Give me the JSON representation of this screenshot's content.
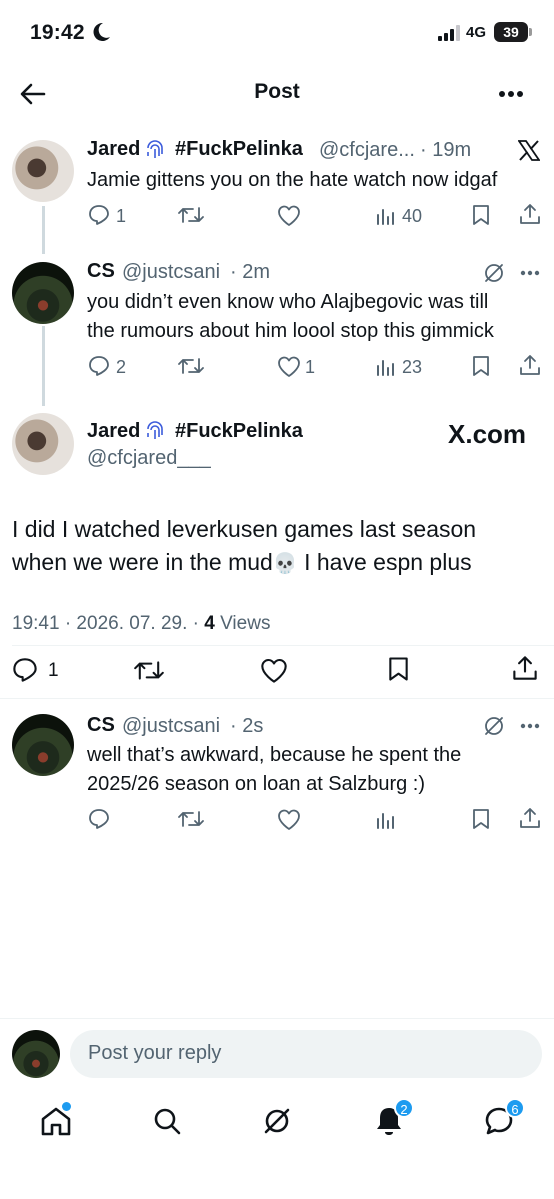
{
  "status_bar": {
    "time": "19:42",
    "network": "4G",
    "battery": "39"
  },
  "header": {
    "title": "Post"
  },
  "replied_post_1": {
    "author_name": "Jared",
    "author_tag": "#FuckPelinka",
    "handle": "@cfcjare...",
    "time": "· 19m",
    "text": "Jamie gittens you on the hate watch now idgaf",
    "replies": "1",
    "reposts": "",
    "likes": "",
    "views": "40"
  },
  "replied_post_2": {
    "author_name": "CS",
    "handle": "@justcsani",
    "time": "· 2m",
    "text_line1": "you didn’t even know who Alajbegovic was till",
    "text_line2": "the rumours about him loool stop this gimmick",
    "replies": "2",
    "likes": "1",
    "views": "23"
  },
  "main_post": {
    "author_name": "Jared",
    "author_tag": "#FuckPelinka",
    "handle": "@cfcjared___",
    "watermark": "X.com",
    "text_line1": "I did I watched leverkusen games last season",
    "text_line2": "when we were in the mud",
    "text_emoji": "💀",
    "text_line2_end": " I have espn plus",
    "timestamp": "19:41 · 2026. 07. 29. · ",
    "views_count": "4",
    "views_label": " Views",
    "replies": "1"
  },
  "reply_post": {
    "author_name": "CS",
    "handle": "@justcsani",
    "time": "· 2s",
    "text_line1": "well that’s awkward, because he spent the",
    "text_line2": "2025/26 season on loan at Salzburg :)"
  },
  "composer": {
    "placeholder": "Post your reply"
  },
  "tab_bar": {
    "notifications_badge": "2",
    "messages_badge": "6"
  },
  "colors": {
    "accent": "#1d9bf0",
    "text": "#0f1419",
    "secondary": "#536471"
  }
}
